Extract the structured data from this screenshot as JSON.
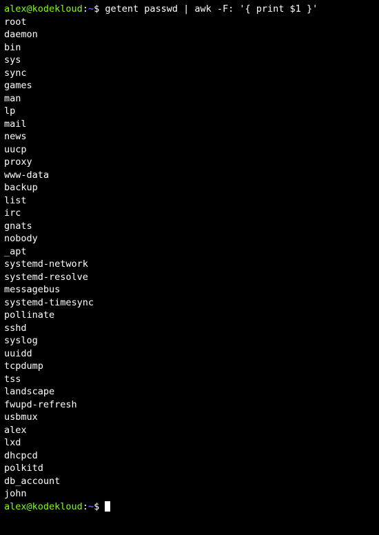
{
  "prompt1": {
    "userhost": "alex@kodekloud",
    "sep1": ":",
    "path": "~",
    "sep2": "$ ",
    "command": "getent passwd | awk -F: '{ print $1 }'"
  },
  "output_lines": [
    "root",
    "daemon",
    "bin",
    "sys",
    "sync",
    "games",
    "man",
    "lp",
    "mail",
    "news",
    "uucp",
    "proxy",
    "www-data",
    "backup",
    "list",
    "irc",
    "gnats",
    "nobody",
    "_apt",
    "systemd-network",
    "systemd-resolve",
    "messagebus",
    "systemd-timesync",
    "pollinate",
    "sshd",
    "syslog",
    "uuidd",
    "tcpdump",
    "tss",
    "landscape",
    "fwupd-refresh",
    "usbmux",
    "alex",
    "lxd",
    "dhcpcd",
    "polkitd",
    "db_account",
    "john"
  ],
  "prompt2": {
    "userhost": "alex@kodekloud",
    "sep1": ":",
    "path": "~",
    "sep2": "$ "
  }
}
